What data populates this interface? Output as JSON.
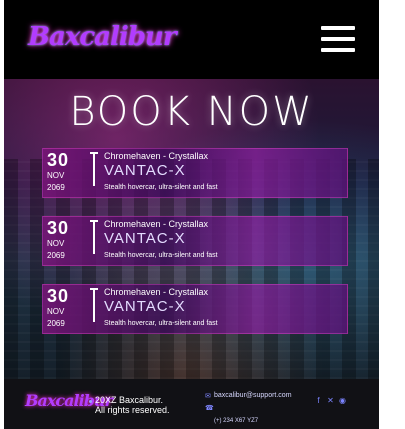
{
  "header": {
    "logo_text": "Baxcalibur",
    "menu_icon": "hamburger-icon"
  },
  "hero": {
    "title": "BOOK NOW"
  },
  "bookings": [
    {
      "day": "30",
      "month": "NOV",
      "year": "2069",
      "route": "Chromehaven - Crystallax",
      "ship": "VANTAC-X",
      "description": "Stealth hovercar, ultra-silent and fast"
    },
    {
      "day": "30",
      "month": "NOV",
      "year": "2069",
      "route": "Chromehaven - Crystallax",
      "ship": "VANTAC-X",
      "description": "Stealth hovercar, ultra-silent and fast"
    },
    {
      "day": "30",
      "month": "NOV",
      "year": "2069",
      "route": "Chromehaven - Crystallax",
      "ship": "VANTAC-X",
      "description": "Stealth hovercar, ultra-silent and fast"
    }
  ],
  "footer": {
    "logo_text": "Baxcalibur",
    "copyright_line1": "20XZ Baxcalibur.",
    "copyright_line2": "All rights reserved.",
    "email": "baxcalibur@support.com",
    "phone": "(+) 234 X67 YZ7",
    "social": [
      "facebook-icon",
      "x-icon",
      "instagram-icon"
    ]
  },
  "colors": {
    "brand": "#b23cff",
    "card": "#78147b",
    "footer_bg": "#121216",
    "accent_icon": "#7b84ff"
  }
}
